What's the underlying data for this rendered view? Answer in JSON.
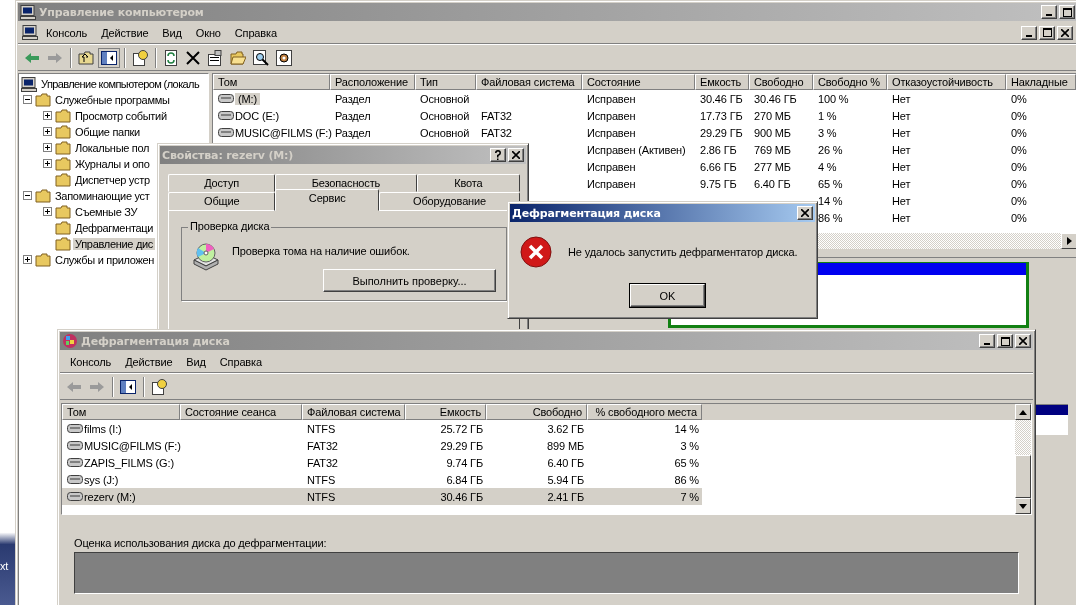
{
  "desktop": {
    "caption": "xt"
  },
  "main_window": {
    "title": "Управление компьютером",
    "menu": [
      "Консоль",
      "Действие",
      "Вид",
      "Окно",
      "Справка"
    ],
    "tree": [
      {
        "label": "Управление компьютером (локаль",
        "selected": false,
        "children": [
          {
            "label": "Служебные программы",
            "kind": "node",
            "expanded": true,
            "selected": false,
            "children": [
              {
                "label": "Просмотр событий",
                "kind": "node",
                "expanded": false,
                "selected": false
              },
              {
                "label": "Общие папки",
                "kind": "node",
                "expanded": false,
                "selected": false
              },
              {
                "label": "Локальные пол",
                "kind": "node",
                "expanded": false,
                "selected": false
              },
              {
                "label": "Журналы и опо",
                "kind": "node",
                "expanded": false,
                "selected": false
              },
              {
                "label": "Диспетчер устр",
                "kind": "leaf",
                "selected": false
              }
            ]
          },
          {
            "label": "Запоминающие уст",
            "kind": "node",
            "expanded": true,
            "selected": false,
            "children": [
              {
                "label": "Съемные ЗУ",
                "kind": "node",
                "expanded": false,
                "selected": false
              },
              {
                "label": "Дефрагментаци",
                "kind": "leaf",
                "selected": false
              },
              {
                "label": "Управление дис",
                "kind": "leaf",
                "selected": true
              }
            ]
          },
          {
            "label": "Службы и приложен",
            "kind": "node",
            "expanded": false,
            "selected": false
          }
        ]
      }
    ],
    "volumes": {
      "columns": [
        "Том",
        "Расположение",
        "Тип",
        "Файловая система",
        "Состояние",
        "Емкость",
        "Свободно",
        "Свободно %",
        "Отказоустойчивость",
        "Накладные"
      ],
      "rows": [
        {
          "volume": "(M:)",
          "selected": true,
          "layout": "Раздел",
          "type": "Основной",
          "status": "Исправен",
          "capacity": "30.46 ГБ",
          "free": "30.46 ГБ",
          "free_pct": "100 %",
          "fault_tolerance": "Нет",
          "overhead": "0%"
        },
        {
          "volume": "DOC (E:)",
          "selected": false,
          "layout": "Раздел",
          "type": "Основной",
          "fs": "FAT32",
          "status": "Исправен",
          "capacity": "17.73 ГБ",
          "free": "270 МБ",
          "free_pct": "1 %",
          "fault_tolerance": "Нет",
          "overhead": "0%"
        },
        {
          "volume": "MUSIC@FILMS (F:)",
          "selected": false,
          "layout": "Раздел",
          "type": "Основной",
          "fs": "FAT32",
          "status": "Исправен",
          "capacity": "29.29 ГБ",
          "free": "900 МБ",
          "free_pct": "3 %",
          "fault_tolerance": "Нет",
          "overhead": "0%"
        },
        {
          "status": "Исправен (Активен)",
          "capacity": "2.86 ГБ",
          "free": "769 МБ",
          "free_pct": "26 %",
          "fault_tolerance": "Нет",
          "overhead": "0%"
        },
        {
          "status": "Исправен",
          "capacity": "6.66 ГБ",
          "free": "277 МБ",
          "free_pct": "4 %",
          "fault_tolerance": "Нет",
          "overhead": "0%"
        },
        {
          "status": "Исправен",
          "capacity": "9.75 ГБ",
          "free": "6.40 ГБ",
          "free_pct": "65 %",
          "fault_tolerance": "Нет",
          "overhead": "0%"
        },
        {
          "free_pct": "14 %",
          "fault_tolerance": "Нет",
          "overhead": "0%"
        },
        {
          "free_pct": "86 %",
          "fault_tolerance": "Нет",
          "overhead": "0%"
        }
      ]
    }
  },
  "properties_dialog": {
    "title": "Свойства: rezerv (M:)",
    "tab_rows": [
      [
        {
          "label": "Доступ",
          "selected": false
        },
        {
          "label": "Безопасность",
          "selected": false
        },
        {
          "label": "Квота",
          "selected": false
        }
      ],
      [
        {
          "label": "Общие",
          "selected": false
        },
        {
          "label": "Сервис",
          "selected": true
        },
        {
          "label": "Оборудование",
          "selected": false
        }
      ]
    ],
    "group": {
      "title": "Проверка диска",
      "text": "Проверка тома на наличие ошибок.",
      "button": "Выполнить проверку..."
    }
  },
  "error_dialog": {
    "title": "Дефрагментация диска",
    "message": "Не удалось запустить дефрагментатор диска.",
    "button": "OK"
  },
  "defrag_window": {
    "title": "Дефрагментация диска",
    "menu": [
      "Консоль",
      "Действие",
      "Вид",
      "Справка"
    ],
    "columns": [
      "Том",
      "Состояние сеанса",
      "Файловая система",
      "Емкость",
      "Свободно",
      "% свободного места"
    ],
    "rows": [
      {
        "volume": "films (I:)",
        "fs": "NTFS",
        "capacity": "25.72 ГБ",
        "free": "3.62 ГБ",
        "free_pct": "14 %",
        "selected": false
      },
      {
        "volume": "MUSIC@FILMS (F:)",
        "fs": "FAT32",
        "capacity": "29.29 ГБ",
        "free": "899 МБ",
        "free_pct": "3 %",
        "selected": false
      },
      {
        "volume": "ZAPIS_FILMS (G:)",
        "fs": "FAT32",
        "capacity": "9.74 ГБ",
        "free": "6.40 ГБ",
        "free_pct": "65 %",
        "selected": false
      },
      {
        "volume": "sys (J:)",
        "fs": "NTFS",
        "capacity": "6.84 ГБ",
        "free": "5.94 ГБ",
        "free_pct": "86 %",
        "selected": false
      },
      {
        "volume": "rezerv (M:)",
        "fs": "NTFS",
        "capacity": "30.46 ГБ",
        "free": "2.41 ГБ",
        "free_pct": "7 %",
        "selected": true
      }
    ],
    "analysis_label": "Оценка использования диска до дефрагментации:"
  }
}
